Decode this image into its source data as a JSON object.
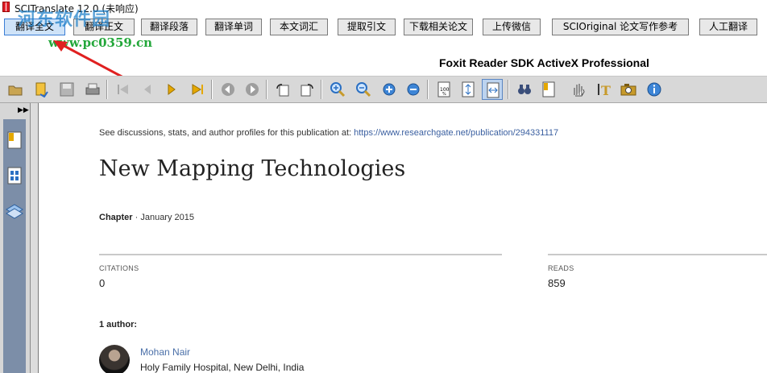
{
  "window": {
    "title": "SCITranslate 12.0 (未响应)"
  },
  "watermark": {
    "text": "河东软件园",
    "url": "www.pc0359.cn"
  },
  "top_buttons": [
    {
      "label": "翻译全文"
    },
    {
      "label": "翻译正文"
    },
    {
      "label": "翻译段落"
    },
    {
      "label": "翻译单词"
    },
    {
      "label": "本文词汇"
    },
    {
      "label": "提取引文"
    },
    {
      "label": "下载相关论文"
    },
    {
      "label": "上传微信"
    },
    {
      "label": "SCIOriginal 论文写作参考"
    },
    {
      "label": "人工翻译"
    }
  ],
  "viewer": {
    "title": "Foxit Reader SDK ActiveX Professional"
  },
  "toolbar": {
    "icons": [
      "open-icon",
      "open-folder-icon",
      "save-icon",
      "print-icon",
      "first-page-icon",
      "prev-page-icon",
      "next-page-icon",
      "last-page-icon",
      "back-icon",
      "forward-icon",
      "rotate-left-icon",
      "rotate-right-icon",
      "zoom-in-icon",
      "zoom-out-icon",
      "zoom-plus-icon",
      "zoom-minus-icon",
      "actual-size-icon",
      "fit-page-icon",
      "fit-width-icon",
      "find-icon",
      "bookmark-icon",
      "hand-tool-icon",
      "text-select-icon",
      "snapshot-icon",
      "info-icon"
    ]
  },
  "document": {
    "discuss_prefix": "See discussions, stats, and author profiles for this publication at: ",
    "discuss_link": "https://www.researchgate.net/publication/294331117",
    "title": "New Mapping Technologies",
    "chapter_label": "Chapter",
    "chapter_date": " · January 2015",
    "citations_label": "CITATIONS",
    "citations_value": "0",
    "reads_label": "READS",
    "reads_value": "859",
    "authors_heading": "1 author:",
    "author_name": "Mohan Nair",
    "author_affiliation": "Holy Family Hospital, New Delhi, India"
  },
  "colors": {
    "accent_blue": "#3c7fd6",
    "link": "#3a5fa0",
    "toolbar_bg": "#d8d8d8",
    "side_blue": "#7c8ea8"
  }
}
